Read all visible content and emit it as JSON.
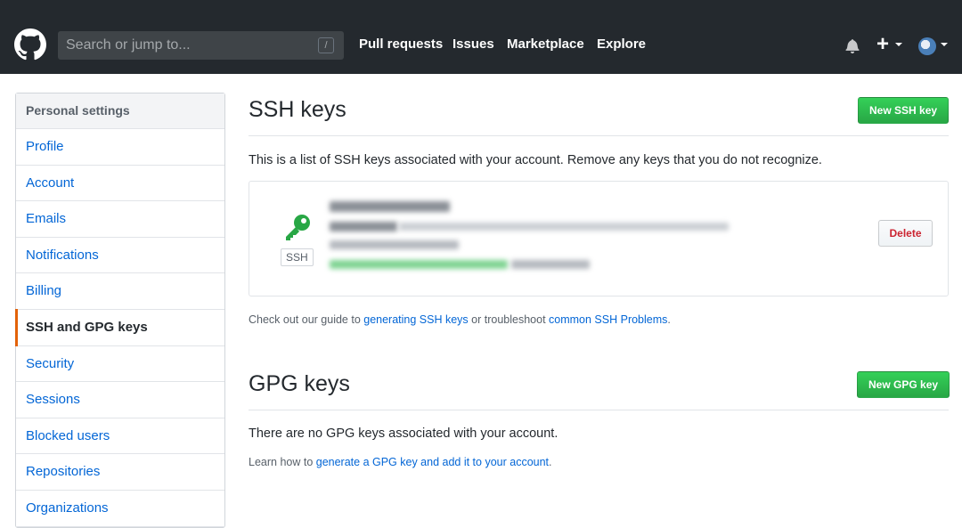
{
  "header": {
    "search_placeholder": "Search or jump to...",
    "search_shortcut": "/",
    "nav": [
      "Pull requests",
      "Issues",
      "Marketplace",
      "Explore"
    ],
    "plus_glyph": "+"
  },
  "sidebar": {
    "heading": "Personal settings",
    "items": [
      {
        "label": "Profile"
      },
      {
        "label": "Account"
      },
      {
        "label": "Emails"
      },
      {
        "label": "Notifications"
      },
      {
        "label": "Billing"
      },
      {
        "label": "SSH and GPG keys",
        "selected": true
      },
      {
        "label": "Security"
      },
      {
        "label": "Sessions"
      },
      {
        "label": "Blocked users"
      },
      {
        "label": "Repositories"
      },
      {
        "label": "Organizations"
      }
    ]
  },
  "ssh": {
    "title": "SSH keys",
    "new_button": "New SSH key",
    "description": "This is a list of SSH keys associated with your account. Remove any keys that you do not recognize.",
    "key": {
      "type_label": "SSH",
      "delete_label": "Delete"
    },
    "guide": {
      "prefix": "Check out our guide to ",
      "link1": "generating SSH keys",
      "middle": " or troubleshoot ",
      "link2": "common SSH Problems",
      "suffix": "."
    }
  },
  "gpg": {
    "title": "GPG keys",
    "new_button": "New GPG key",
    "empty": "There are no GPG keys associated with your account.",
    "learn": {
      "prefix": "Learn how to ",
      "link": "generate a GPG key and add it to your account",
      "suffix": "."
    }
  },
  "colors": {
    "header_bg": "#24292e",
    "link": "#0366d6",
    "green": "#28a745",
    "danger": "#cb2431",
    "selected_marker": "#e36209"
  }
}
